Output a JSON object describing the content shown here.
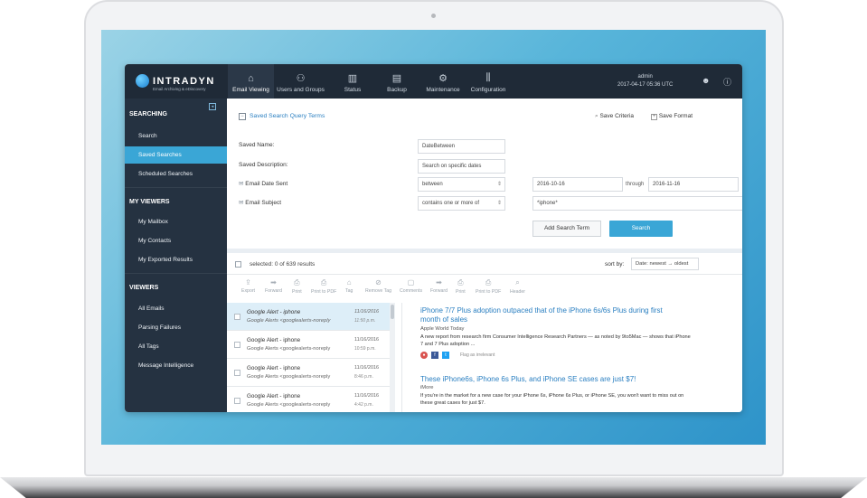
{
  "brand": {
    "name": "INTRADYN",
    "tagline": "Email Archiving & eDiscovery"
  },
  "nav": [
    {
      "label": "Email Viewing",
      "icon": "home-icon"
    },
    {
      "label": "Users and Groups",
      "icon": "users-icon"
    },
    {
      "label": "Status",
      "icon": "bar-chart-icon"
    },
    {
      "label": "Backup",
      "icon": "backup-icon"
    },
    {
      "label": "Maintenance",
      "icon": "gear-icon"
    },
    {
      "label": "Configuration",
      "icon": "sliders-icon"
    }
  ],
  "user": {
    "name": "admin",
    "datetime": "2017-04-17 05:36 UTC"
  },
  "sidebar": {
    "searching_title": "SEARCHING",
    "searching_items": [
      "Search",
      "Saved Searches",
      "Scheduled Searches"
    ],
    "viewers_mine_title": "MY VIEWERS",
    "viewers_mine_items": [
      "My Mailbox",
      "My Contacts",
      "My Exported Results"
    ],
    "viewers_title": "VIEWERS",
    "viewers_items": [
      "All Emails",
      "Parsing Failures",
      "All Tags",
      "Message Intelligence"
    ]
  },
  "query": {
    "section_title": "Saved Search Query Terms",
    "save_criteria": "Save Criteria",
    "save_format": "Save Format",
    "saved_name_label": "Saved Name:",
    "saved_name_value": "DateBetween",
    "saved_desc_label": "Saved Description:",
    "saved_desc_value": "Search on specific dates",
    "date_label": "Email Date Sent",
    "date_op": "between",
    "date_from": "2016-10-16",
    "through_label": "through",
    "date_to": "2016-11-16",
    "subject_label": "Email Subject",
    "subject_op": "contains one or more of",
    "subject_value": "*iphone*",
    "add_term": "Add Search Term",
    "search": "Search"
  },
  "results": {
    "selected": "selected: 0 of 639 results",
    "sort_label": "sort by:",
    "sort_value": "Date: newest → oldest"
  },
  "list_tools": [
    "Export",
    "Forward",
    "Print",
    "Print to PDF",
    "Tag",
    "Remove Tag"
  ],
  "preview_tools": [
    "Comments",
    "Forward",
    "Print",
    "Print to PDF",
    "Header"
  ],
  "emails": [
    {
      "subject": "Google Alert - iphone",
      "from": "Google Alerts <googlealerts-noreply",
      "date": "11/16/2016",
      "time": "11:50 p.m."
    },
    {
      "subject": "Google Alert - iphone",
      "from": "Google Alerts <googlealerts-noreply",
      "date": "11/16/2016",
      "time": "10:59 p.m."
    },
    {
      "subject": "Google Alert - iphone",
      "from": "Google Alerts <googlealerts-noreply",
      "date": "11/16/2016",
      "time": "8:46 p.m."
    },
    {
      "subject": "Google Alert - iphone",
      "from": "Google Alerts <googlealerts-noreply",
      "date": "11/16/2016",
      "time": "4:42 p.m."
    }
  ],
  "preview": {
    "a1_title": "iPhone 7/7 Plus adoption outpaced that of the iPhone 6s/6s Plus during first month of sales",
    "a1_source": "Apple World Today",
    "a1_body": "A new report from research firm Consumer Intelligence Research Partners — as noted by 9to5Mac — shows that iPhone 7 and 7 Plus adoption ...",
    "flag_label": "Flag as irrelevant",
    "a2_title": "These iPhone6s, iPhone 6s Plus, and iPhone SE cases are just $7!",
    "a2_source": "iMore",
    "a2_body": "If you're in the market for a new case for your iPhone 6s, iPhone 6s Plus, or iPhone SE, you won't want to miss out on these great cases for just $7."
  },
  "colors": {
    "topbar": "#1f2a37",
    "sidebar": "#253241",
    "accent": "#3aa6d6",
    "link": "#2a7fc1"
  }
}
